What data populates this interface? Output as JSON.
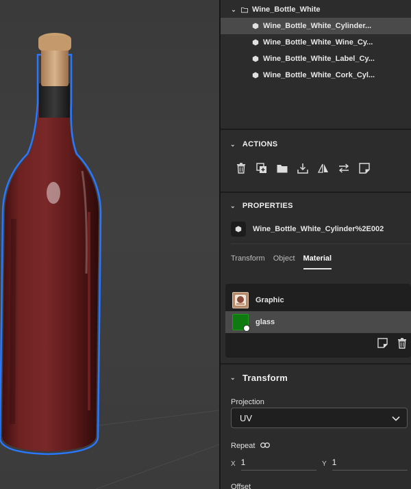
{
  "layers": {
    "group": "Wine_Bottle_White",
    "items": [
      {
        "label": "Wine_Bottle_White_Cylinder...",
        "selected": true,
        "hidden": false
      },
      {
        "label": "Wine_Bottle_White_Wine_Cy...",
        "selected": false,
        "hidden": false
      },
      {
        "label": "Wine_Bottle_White_Label_Cy...",
        "selected": false,
        "hidden": true
      },
      {
        "label": "Wine_Bottle_White_Cork_Cyl...",
        "selected": false,
        "hidden": false
      }
    ]
  },
  "actions": {
    "title": "ACTIONS",
    "buttons": [
      "trash-icon",
      "duplicate-icon",
      "folder-icon",
      "download-icon",
      "flip-icon",
      "swap-icon",
      "sticker-icon"
    ]
  },
  "properties": {
    "title": "PROPERTIES",
    "object_name": "Wine_Bottle_White_Cylinder%2E002",
    "tabs": [
      {
        "label": "Transform",
        "active": false
      },
      {
        "label": "Object",
        "active": false
      },
      {
        "label": "Material",
        "active": true
      }
    ],
    "materials": [
      {
        "label": "Graphic",
        "selected": false,
        "color": "#b48a6a"
      },
      {
        "label": "glass",
        "selected": true,
        "color": "#0f7a0f"
      }
    ]
  },
  "transform": {
    "title": "Transform",
    "projection_label": "Projection",
    "projection_value": "UV",
    "repeat_label": "Repeat",
    "repeat_x_axis": "X",
    "repeat_x": "1",
    "repeat_y_axis": "Y",
    "repeat_y": "1",
    "offset_label": "Offset"
  },
  "colors": {
    "panel_bg": "#2c2c2c",
    "selection": "#4a4a4a",
    "outline_blue": "#2a78ff",
    "wine": "#5e1a1a"
  }
}
